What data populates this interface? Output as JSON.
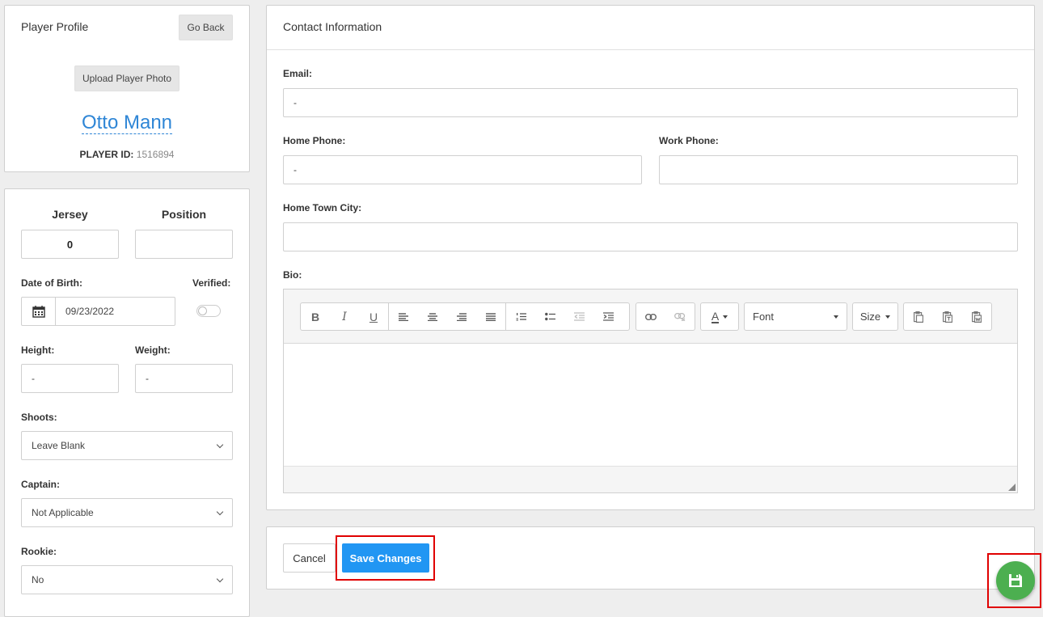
{
  "profile": {
    "title": "Player Profile",
    "go_back": "Go Back",
    "upload_photo": "Upload Player Photo",
    "name": "Otto Mann",
    "player_id_label": "PLAYER ID",
    "player_id_sep": ":",
    "player_id": "1516894"
  },
  "details": {
    "jersey_label": "Jersey",
    "jersey_value": "0",
    "position_label": "Position",
    "position_value": "",
    "dob_label": "Date of Birth:",
    "dob_value": "09/23/2022",
    "verified_label": "Verified:",
    "verified_on": false,
    "height_label": "Height:",
    "height_value": "-",
    "weight_label": "Weight:",
    "weight_value": "-",
    "shoots_label": "Shoots:",
    "shoots_value": "Leave Blank",
    "captain_label": "Captain:",
    "captain_value": "Not Applicable",
    "rookie_label": "Rookie:",
    "rookie_value": "No"
  },
  "contact": {
    "title": "Contact Information",
    "email_label": "Email:",
    "email_value": "-",
    "home_phone_label": "Home Phone:",
    "home_phone_value": "-",
    "work_phone_label": "Work Phone:",
    "work_phone_value": "",
    "hometown_label": "Home Town City:",
    "hometown_value": "",
    "bio_label": "Bio:",
    "editor": {
      "bold": "B",
      "italic": "I",
      "underline": "U",
      "font_color": "A",
      "font_select": "Font",
      "size_select": "Size"
    }
  },
  "actions": {
    "cancel": "Cancel",
    "save": "Save Changes"
  },
  "colors": {
    "accent_blue": "#2196f3",
    "name_blue": "#2f86d6",
    "fab_green": "#4caf50",
    "highlight_red": "#e00000"
  }
}
